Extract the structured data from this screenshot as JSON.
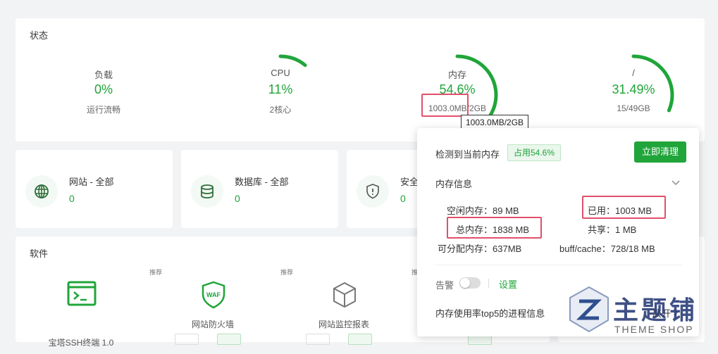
{
  "status": {
    "title": "状态",
    "gauges": [
      {
        "label": "负载",
        "value": "0%",
        "sub": "运行流畅",
        "percent": 0
      },
      {
        "label": "CPU",
        "value": "11%",
        "sub": "2核心",
        "percent": 11
      },
      {
        "label": "内存",
        "value": "54.6%",
        "sub": "1003.0MB/2GB",
        "percent": 54.6
      },
      {
        "label": "/",
        "value": "31.49%",
        "sub": "15/49GB",
        "percent": 31.49
      }
    ],
    "tooltip": "1003.0MB/2GB"
  },
  "summary": [
    {
      "title": "网站 - 全部",
      "count": "0",
      "icon": "globe-icon"
    },
    {
      "title": "数据库 - 全部",
      "count": "0",
      "icon": "database-icon"
    },
    {
      "title": "安全",
      "count": "0",
      "icon": "shield-icon"
    }
  ],
  "software": {
    "title": "软件",
    "items": [
      {
        "name": "宝塔SSH终端 1.0",
        "tag": "",
        "icon": "terminal-icon"
      },
      {
        "name": "网站防火墙",
        "tag": "推荐",
        "icon": "waf-shield-icon",
        "icon_text": "WAF"
      },
      {
        "name": "网站监控报表",
        "tag": "推荐",
        "icon": "cube-icon"
      },
      {
        "name": "",
        "tag": "推",
        "icon": ""
      }
    ]
  },
  "memory_popup": {
    "detected": "检测到当前内存",
    "badge": "占用54.6%",
    "clean_button": "立即清理",
    "info_title": "内存信息",
    "free": "空闲内存：89 MB",
    "used": "已用：1003 MB",
    "total": "总内存：1838 MB",
    "shared": "共享：1 MB",
    "available": "可分配内存：637MB",
    "buff_cache": "buff/cache：728/18 MB",
    "alarm_label": "告警",
    "settings_link": "设置",
    "top5_title": "内存使用率top5的进程信息",
    "expand_label": "展开"
  },
  "watermark": {
    "text_cn": "主题铺",
    "text_en": "THEME SHOP"
  },
  "colors": {
    "accent": "#20a53a",
    "highlight": "#e0506a"
  }
}
